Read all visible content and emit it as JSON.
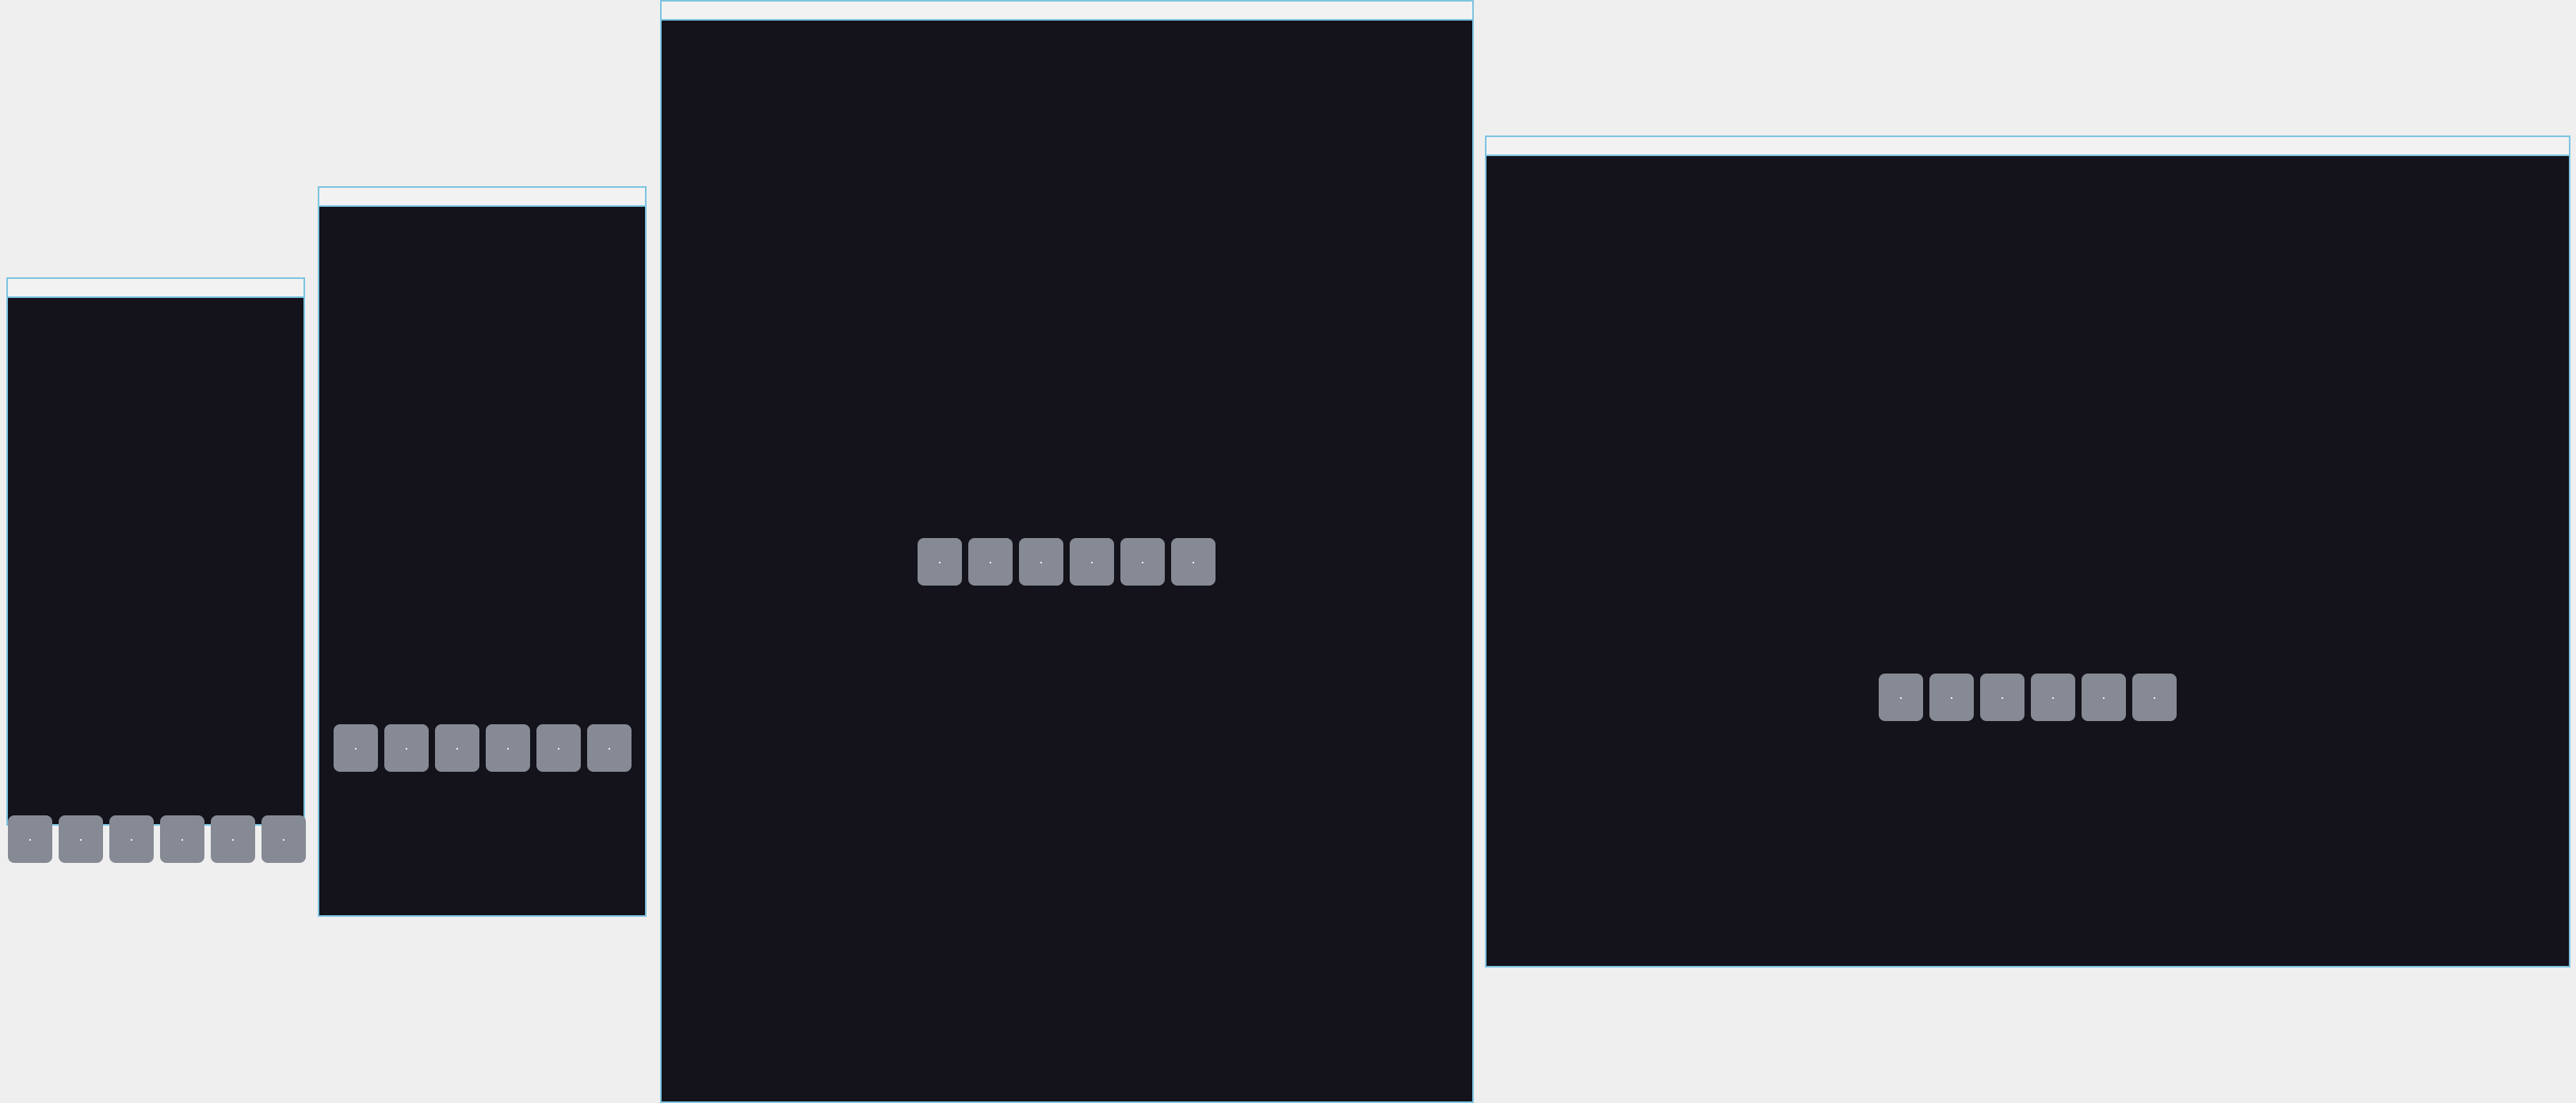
{
  "colors": {
    "page_background": "#efefef",
    "frame_border": "#7cc4e0",
    "frame_content": "#14121a",
    "titlebar_background": "#f2f2f2",
    "titlebar_text": "#cfcfcf",
    "pad": "#868a94",
    "pad_dot": "#ffffff"
  },
  "frames": [
    {
      "title": "",
      "pads": [
        "·",
        "·",
        "·",
        "·",
        "·",
        "·"
      ]
    },
    {
      "title": "",
      "pads": [
        "·",
        "·",
        "·",
        "·",
        "·",
        "·"
      ]
    },
    {
      "title": "",
      "pads": [
        "·",
        "·",
        "·",
        "·",
        "·",
        "·"
      ]
    },
    {
      "title": "",
      "pads": [
        "·",
        "·",
        "·",
        "·",
        "·",
        "·"
      ]
    }
  ]
}
